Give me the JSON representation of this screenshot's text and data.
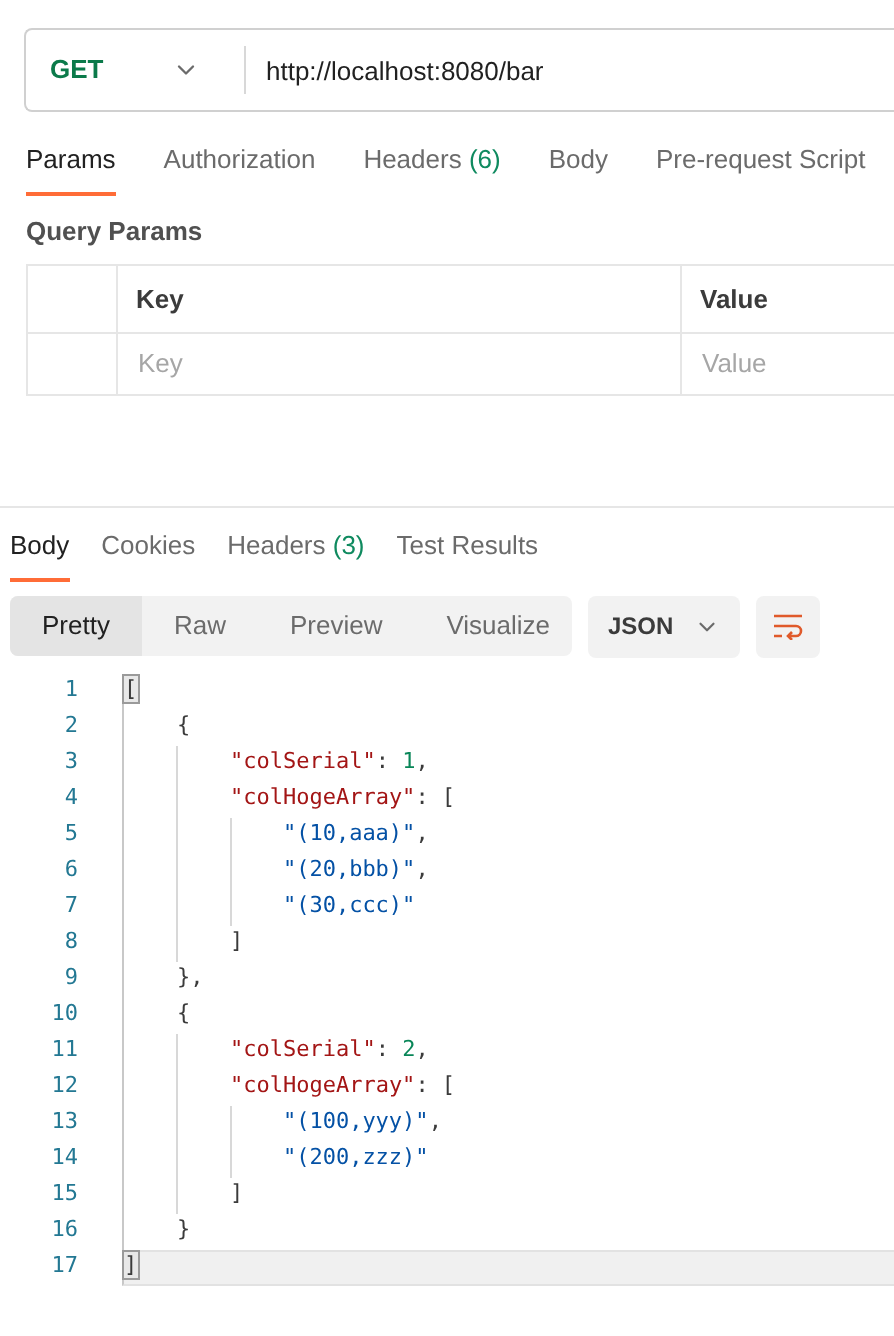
{
  "request": {
    "method": "GET",
    "url": "http://localhost:8080/bar"
  },
  "request_tabs": [
    {
      "label": "Params",
      "selected": true
    },
    {
      "label": "Authorization",
      "selected": false
    },
    {
      "label": "Headers",
      "count": "(6)",
      "selected": false
    },
    {
      "label": "Body",
      "selected": false
    },
    {
      "label": "Pre-request Script",
      "selected": false
    }
  ],
  "query_params": {
    "title": "Query Params",
    "columns": [
      "Key",
      "Value"
    ],
    "placeholders": [
      "Key",
      "Value"
    ]
  },
  "response_tabs": [
    {
      "label": "Body",
      "selected": true
    },
    {
      "label": "Cookies",
      "selected": false
    },
    {
      "label": "Headers",
      "count": "(3)",
      "selected": false
    },
    {
      "label": "Test Results",
      "selected": false
    }
  ],
  "view_modes": [
    {
      "label": "Pretty",
      "selected": true
    },
    {
      "label": "Raw",
      "selected": false
    },
    {
      "label": "Preview",
      "selected": false
    },
    {
      "label": "Visualize",
      "selected": false
    }
  ],
  "format": "JSON",
  "code_lines": [
    {
      "number": "1",
      "current": false,
      "tokens": [
        {
          "kind": "punct",
          "text": "[",
          "highlighted": true
        }
      ]
    },
    {
      "number": "2",
      "current": false,
      "tokens": [
        {
          "kind": "punct",
          "text": "{"
        }
      ]
    },
    {
      "number": "3",
      "current": false,
      "tokens": [
        {
          "kind": "key",
          "text": "\"colSerial\""
        },
        {
          "kind": "punct",
          "text": ": "
        },
        {
          "kind": "number",
          "text": "1"
        },
        {
          "kind": "punct",
          "text": ","
        }
      ]
    },
    {
      "number": "4",
      "current": false,
      "tokens": [
        {
          "kind": "key",
          "text": "\"colHogeArray\""
        },
        {
          "kind": "punct",
          "text": ": ["
        }
      ]
    },
    {
      "number": "5",
      "current": false,
      "tokens": [
        {
          "kind": "string",
          "text": "\"(10,aaa)\""
        },
        {
          "kind": "punct",
          "text": ","
        }
      ]
    },
    {
      "number": "6",
      "current": false,
      "tokens": [
        {
          "kind": "string",
          "text": "\"(20,bbb)\""
        },
        {
          "kind": "punct",
          "text": ","
        }
      ]
    },
    {
      "number": "7",
      "current": false,
      "tokens": [
        {
          "kind": "string",
          "text": "\"(30,ccc)\""
        }
      ]
    },
    {
      "number": "8",
      "current": false,
      "tokens": [
        {
          "kind": "punct",
          "text": "]"
        }
      ]
    },
    {
      "number": "9",
      "current": false,
      "tokens": [
        {
          "kind": "punct",
          "text": "},"
        }
      ]
    },
    {
      "number": "10",
      "current": false,
      "tokens": [
        {
          "kind": "punct",
          "text": "{"
        }
      ]
    },
    {
      "number": "11",
      "current": false,
      "tokens": [
        {
          "kind": "key",
          "text": "\"colSerial\""
        },
        {
          "kind": "punct",
          "text": ": "
        },
        {
          "kind": "number",
          "text": "2"
        },
        {
          "kind": "punct",
          "text": ","
        }
      ]
    },
    {
      "number": "12",
      "current": false,
      "tokens": [
        {
          "kind": "key",
          "text": "\"colHogeArray\""
        },
        {
          "kind": "punct",
          "text": ": ["
        }
      ]
    },
    {
      "number": "13",
      "current": false,
      "tokens": [
        {
          "kind": "string",
          "text": "\"(100,yyy)\""
        },
        {
          "kind": "punct",
          "text": ","
        }
      ]
    },
    {
      "number": "14",
      "current": false,
      "tokens": [
        {
          "kind": "string",
          "text": "\"(200,zzz)\""
        }
      ]
    },
    {
      "number": "15",
      "current": false,
      "tokens": [
        {
          "kind": "punct",
          "text": "]"
        }
      ]
    },
    {
      "number": "16",
      "current": false,
      "tokens": [
        {
          "kind": "punct",
          "text": "}"
        }
      ]
    },
    {
      "number": "17",
      "current": true,
      "tokens": [
        {
          "kind": "punct",
          "text": "]",
          "highlighted": true
        }
      ]
    }
  ]
}
